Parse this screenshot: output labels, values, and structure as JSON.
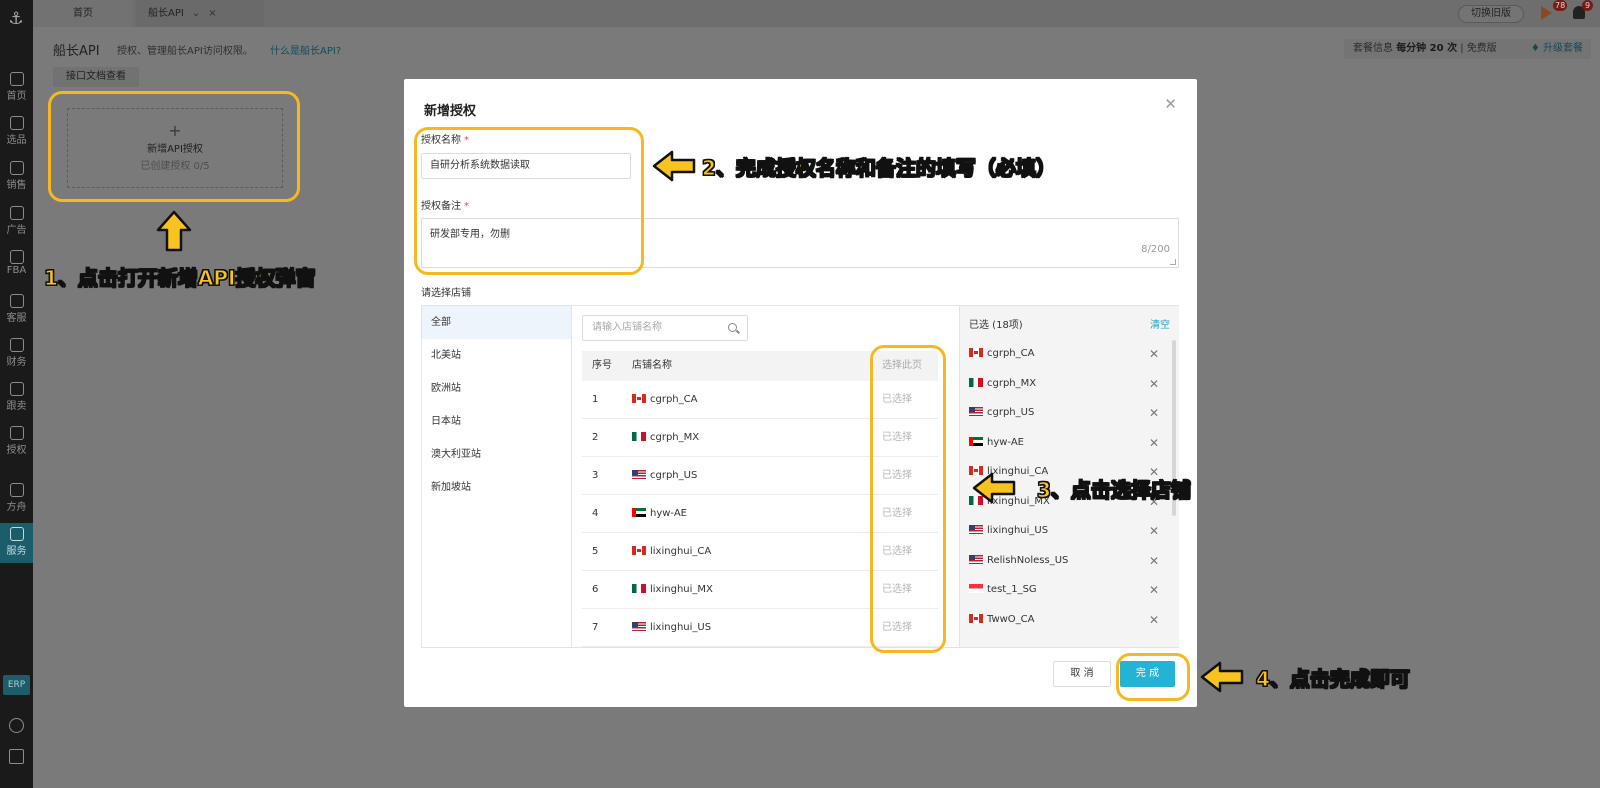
{
  "sidebar": {
    "items": [
      {
        "label": "首页",
        "icon": "home-icon"
      },
      {
        "label": "选品",
        "icon": "search-icon"
      },
      {
        "label": "销售",
        "icon": "chart-icon"
      },
      {
        "label": "广告",
        "icon": "ad-icon"
      },
      {
        "label": "FBA",
        "icon": "warehouse-icon"
      },
      {
        "label": "客服",
        "icon": "chat-icon"
      },
      {
        "label": "财务",
        "icon": "dollar-icon"
      },
      {
        "label": "跟卖",
        "icon": "pie-icon"
      },
      {
        "label": "授权",
        "icon": "shield-icon"
      },
      {
        "label": "方舟",
        "icon": "ark-icon"
      },
      {
        "label": "服务",
        "icon": "service-icon"
      }
    ],
    "erp_label": "ERP"
  },
  "tabs": [
    {
      "label": "首页"
    },
    {
      "label": "船长API"
    }
  ],
  "topbar": {
    "switch_old": "切换旧版",
    "flag_badge": "78",
    "bell_badge": "9"
  },
  "page": {
    "title": "船长API",
    "desc": "授权、管理船长API访问权限。",
    "link": "什么是船长API?",
    "package_label": "套餐信息",
    "package_rate": "每分钟 20 次",
    "package_type": "免费版",
    "upgrade": "升级套餐",
    "doc_tab": "接口文档查看",
    "add_card_title": "新增API授权",
    "add_card_sub": "已创建授权 0/5"
  },
  "dialog": {
    "title": "新增授权",
    "name_label": "授权名称",
    "name_value": "自研分析系统数据读取",
    "remark_label": "授权备注",
    "remark_value": "研发部专用，勿删",
    "remark_counter": "8/200",
    "shop_label": "请选择店铺",
    "search_placeholder": "请输入店铺名称",
    "col_index": "序号",
    "col_name": "店铺名称",
    "col_action": "选择此页",
    "selected_head": "已选 (18项)",
    "clear": "清空",
    "cancel": "取 消",
    "done": "完 成",
    "regions": [
      "全部",
      "北美站",
      "欧洲站",
      "日本站",
      "澳大利亚站",
      "新加坡站"
    ],
    "shops": [
      {
        "idx": "1",
        "name": "cgrph_CA",
        "flag": "ca",
        "action": "已选择"
      },
      {
        "idx": "2",
        "name": "cgrph_MX",
        "flag": "mx",
        "action": "已选择"
      },
      {
        "idx": "3",
        "name": "cgrph_US",
        "flag": "us",
        "action": "已选择"
      },
      {
        "idx": "4",
        "name": "hyw-AE",
        "flag": "ae",
        "action": "已选择"
      },
      {
        "idx": "5",
        "name": "lixinghui_CA",
        "flag": "ca",
        "action": "已选择"
      },
      {
        "idx": "6",
        "name": "lixinghui_MX",
        "flag": "mx",
        "action": "已选择"
      },
      {
        "idx": "7",
        "name": "lixinghui_US",
        "flag": "us",
        "action": "已选择"
      }
    ],
    "selected": [
      {
        "name": "cgrph_CA",
        "flag": "ca"
      },
      {
        "name": "cgrph_MX",
        "flag": "mx"
      },
      {
        "name": "cgrph_US",
        "flag": "us"
      },
      {
        "name": "hyw-AE",
        "flag": "ae"
      },
      {
        "name": "lixinghui_CA",
        "flag": "ca"
      },
      {
        "name": "lixinghui_MX",
        "flag": "mx"
      },
      {
        "name": "lixinghui_US",
        "flag": "us"
      },
      {
        "name": "RelishNoless_US",
        "flag": "us"
      },
      {
        "name": "test_1_SG",
        "flag": "sg"
      },
      {
        "name": "TwwO_CA",
        "flag": "ca"
      }
    ]
  },
  "annotations": {
    "step1": "1、点击打开新增API授权弹窗",
    "step2": "2、完成授权名称和备注的填写（必填）",
    "step3": "3、点击选择店铺",
    "step4": "4、点击完成即可",
    "color": "#f6b820"
  }
}
